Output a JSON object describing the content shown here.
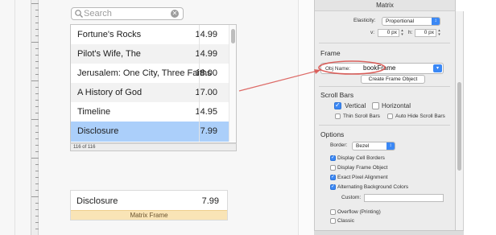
{
  "window": {
    "title": "Matrix"
  },
  "search": {
    "placeholder": "Search"
  },
  "list": {
    "rows": [
      {
        "title": "Fortune's Rocks",
        "price": "14.99"
      },
      {
        "title": "Pilot's Wife, The",
        "price": "14.99"
      },
      {
        "title": "Jerusalem: One City, Three Faiths",
        "price": "18.00"
      },
      {
        "title": "A History of God",
        "price": "17.00"
      },
      {
        "title": "Timeline",
        "price": "14.95"
      },
      {
        "title": "Disclosure",
        "price": "7.99"
      }
    ],
    "selected_row": "Disclosure",
    "footer_count": "116 of 116"
  },
  "matrix_frame": {
    "title": "Disclosure",
    "price": "7.99",
    "label": "Matrix Frame"
  },
  "inspector": {
    "elasticity": {
      "label": "Elasticity:",
      "value": "Proportional"
    },
    "v": {
      "label": "v:",
      "value": "0 px"
    },
    "h": {
      "label": "h:",
      "value": "0 px"
    },
    "frame": {
      "header": "Frame",
      "obj_name_label": "Obj Name:",
      "obj_name_value": "bookFrame",
      "create_button": "Create Frame Object"
    },
    "scroll_bars": {
      "header": "Scroll Bars",
      "vertical": {
        "label": "Vertical",
        "checked": true
      },
      "horizontal": {
        "label": "Horizontal",
        "checked": false
      },
      "thin": {
        "label": "Thin Scroll Bars",
        "checked": false
      },
      "auto_hide": {
        "label": "Auto Hide Scroll Bars",
        "checked": false
      }
    },
    "options": {
      "header": "Options",
      "border_label": "Border:",
      "border_value": "Bezel",
      "display_cell_borders": {
        "label": "Display Cell Borders",
        "checked": true
      },
      "display_frame_object": {
        "label": "Display Frame Object",
        "checked": false
      },
      "exact_pixel_alignment": {
        "label": "Exact Pixel Alignment",
        "checked": true
      },
      "alternating_bg": {
        "label": "Alternating Background Colors",
        "checked": true
      },
      "custom_label": "Custom:",
      "overflow": {
        "label": "Overflow (Printing)",
        "checked": false
      },
      "classic": {
        "label": "Classic",
        "checked": false
      }
    }
  },
  "colors": {
    "selection": "#abcffa",
    "accent_blue": "#3b88f5",
    "frame_label_bg": "#f9e4b6",
    "callout_red": "#d9534f"
  },
  "icons": {
    "search": "magnifier",
    "clear": "x-circle",
    "popup": "chevron-updown"
  }
}
